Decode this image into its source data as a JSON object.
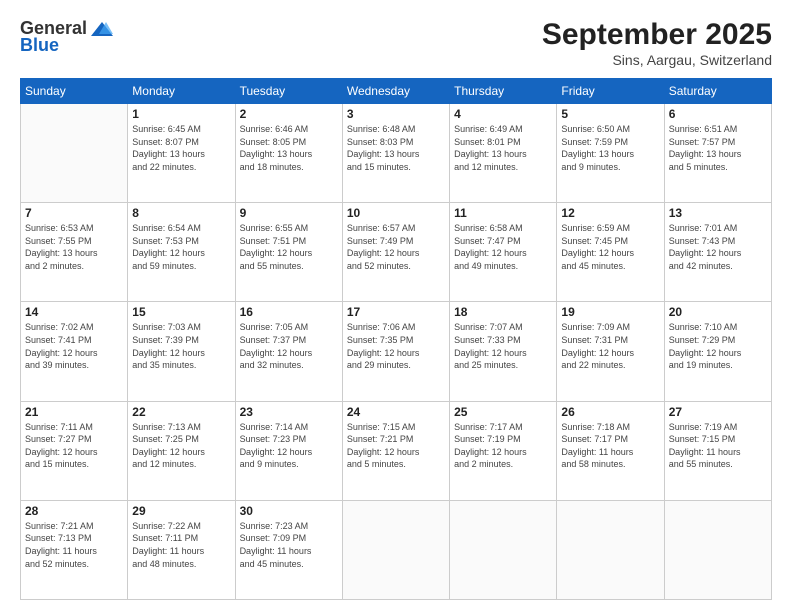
{
  "logo": {
    "general": "General",
    "blue": "Blue"
  },
  "header": {
    "month": "September 2025",
    "location": "Sins, Aargau, Switzerland"
  },
  "weekdays": [
    "Sunday",
    "Monday",
    "Tuesday",
    "Wednesday",
    "Thursday",
    "Friday",
    "Saturday"
  ],
  "weeks": [
    [
      {
        "day": "",
        "info": ""
      },
      {
        "day": "1",
        "info": "Sunrise: 6:45 AM\nSunset: 8:07 PM\nDaylight: 13 hours\nand 22 minutes."
      },
      {
        "day": "2",
        "info": "Sunrise: 6:46 AM\nSunset: 8:05 PM\nDaylight: 13 hours\nand 18 minutes."
      },
      {
        "day": "3",
        "info": "Sunrise: 6:48 AM\nSunset: 8:03 PM\nDaylight: 13 hours\nand 15 minutes."
      },
      {
        "day": "4",
        "info": "Sunrise: 6:49 AM\nSunset: 8:01 PM\nDaylight: 13 hours\nand 12 minutes."
      },
      {
        "day": "5",
        "info": "Sunrise: 6:50 AM\nSunset: 7:59 PM\nDaylight: 13 hours\nand 9 minutes."
      },
      {
        "day": "6",
        "info": "Sunrise: 6:51 AM\nSunset: 7:57 PM\nDaylight: 13 hours\nand 5 minutes."
      }
    ],
    [
      {
        "day": "7",
        "info": "Sunrise: 6:53 AM\nSunset: 7:55 PM\nDaylight: 13 hours\nand 2 minutes."
      },
      {
        "day": "8",
        "info": "Sunrise: 6:54 AM\nSunset: 7:53 PM\nDaylight: 12 hours\nand 59 minutes."
      },
      {
        "day": "9",
        "info": "Sunrise: 6:55 AM\nSunset: 7:51 PM\nDaylight: 12 hours\nand 55 minutes."
      },
      {
        "day": "10",
        "info": "Sunrise: 6:57 AM\nSunset: 7:49 PM\nDaylight: 12 hours\nand 52 minutes."
      },
      {
        "day": "11",
        "info": "Sunrise: 6:58 AM\nSunset: 7:47 PM\nDaylight: 12 hours\nand 49 minutes."
      },
      {
        "day": "12",
        "info": "Sunrise: 6:59 AM\nSunset: 7:45 PM\nDaylight: 12 hours\nand 45 minutes."
      },
      {
        "day": "13",
        "info": "Sunrise: 7:01 AM\nSunset: 7:43 PM\nDaylight: 12 hours\nand 42 minutes."
      }
    ],
    [
      {
        "day": "14",
        "info": "Sunrise: 7:02 AM\nSunset: 7:41 PM\nDaylight: 12 hours\nand 39 minutes."
      },
      {
        "day": "15",
        "info": "Sunrise: 7:03 AM\nSunset: 7:39 PM\nDaylight: 12 hours\nand 35 minutes."
      },
      {
        "day": "16",
        "info": "Sunrise: 7:05 AM\nSunset: 7:37 PM\nDaylight: 12 hours\nand 32 minutes."
      },
      {
        "day": "17",
        "info": "Sunrise: 7:06 AM\nSunset: 7:35 PM\nDaylight: 12 hours\nand 29 minutes."
      },
      {
        "day": "18",
        "info": "Sunrise: 7:07 AM\nSunset: 7:33 PM\nDaylight: 12 hours\nand 25 minutes."
      },
      {
        "day": "19",
        "info": "Sunrise: 7:09 AM\nSunset: 7:31 PM\nDaylight: 12 hours\nand 22 minutes."
      },
      {
        "day": "20",
        "info": "Sunrise: 7:10 AM\nSunset: 7:29 PM\nDaylight: 12 hours\nand 19 minutes."
      }
    ],
    [
      {
        "day": "21",
        "info": "Sunrise: 7:11 AM\nSunset: 7:27 PM\nDaylight: 12 hours\nand 15 minutes."
      },
      {
        "day": "22",
        "info": "Sunrise: 7:13 AM\nSunset: 7:25 PM\nDaylight: 12 hours\nand 12 minutes."
      },
      {
        "day": "23",
        "info": "Sunrise: 7:14 AM\nSunset: 7:23 PM\nDaylight: 12 hours\nand 9 minutes."
      },
      {
        "day": "24",
        "info": "Sunrise: 7:15 AM\nSunset: 7:21 PM\nDaylight: 12 hours\nand 5 minutes."
      },
      {
        "day": "25",
        "info": "Sunrise: 7:17 AM\nSunset: 7:19 PM\nDaylight: 12 hours\nand 2 minutes."
      },
      {
        "day": "26",
        "info": "Sunrise: 7:18 AM\nSunset: 7:17 PM\nDaylight: 11 hours\nand 58 minutes."
      },
      {
        "day": "27",
        "info": "Sunrise: 7:19 AM\nSunset: 7:15 PM\nDaylight: 11 hours\nand 55 minutes."
      }
    ],
    [
      {
        "day": "28",
        "info": "Sunrise: 7:21 AM\nSunset: 7:13 PM\nDaylight: 11 hours\nand 52 minutes."
      },
      {
        "day": "29",
        "info": "Sunrise: 7:22 AM\nSunset: 7:11 PM\nDaylight: 11 hours\nand 48 minutes."
      },
      {
        "day": "30",
        "info": "Sunrise: 7:23 AM\nSunset: 7:09 PM\nDaylight: 11 hours\nand 45 minutes."
      },
      {
        "day": "",
        "info": ""
      },
      {
        "day": "",
        "info": ""
      },
      {
        "day": "",
        "info": ""
      },
      {
        "day": "",
        "info": ""
      }
    ]
  ]
}
